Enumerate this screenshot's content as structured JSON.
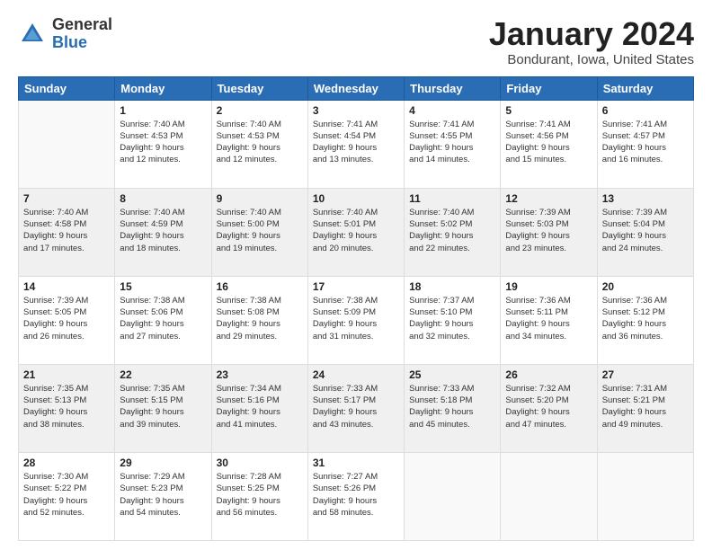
{
  "header": {
    "logo_general": "General",
    "logo_blue": "Blue",
    "title": "January 2024",
    "location": "Bondurant, Iowa, United States"
  },
  "columns": [
    "Sunday",
    "Monday",
    "Tuesday",
    "Wednesday",
    "Thursday",
    "Friday",
    "Saturday"
  ],
  "weeks": [
    [
      {
        "day": "",
        "content": ""
      },
      {
        "day": "1",
        "content": "Sunrise: 7:40 AM\nSunset: 4:53 PM\nDaylight: 9 hours\nand 12 minutes."
      },
      {
        "day": "2",
        "content": "Sunrise: 7:40 AM\nSunset: 4:53 PM\nDaylight: 9 hours\nand 12 minutes."
      },
      {
        "day": "3",
        "content": "Sunrise: 7:41 AM\nSunset: 4:54 PM\nDaylight: 9 hours\nand 13 minutes."
      },
      {
        "day": "4",
        "content": "Sunrise: 7:41 AM\nSunset: 4:55 PM\nDaylight: 9 hours\nand 14 minutes."
      },
      {
        "day": "5",
        "content": "Sunrise: 7:41 AM\nSunset: 4:56 PM\nDaylight: 9 hours\nand 15 minutes."
      },
      {
        "day": "6",
        "content": "Sunrise: 7:41 AM\nSunset: 4:57 PM\nDaylight: 9 hours\nand 16 minutes."
      }
    ],
    [
      {
        "day": "7",
        "content": "Sunrise: 7:40 AM\nSunset: 4:58 PM\nDaylight: 9 hours\nand 17 minutes."
      },
      {
        "day": "8",
        "content": "Sunrise: 7:40 AM\nSunset: 4:59 PM\nDaylight: 9 hours\nand 18 minutes."
      },
      {
        "day": "9",
        "content": "Sunrise: 7:40 AM\nSunset: 5:00 PM\nDaylight: 9 hours\nand 19 minutes."
      },
      {
        "day": "10",
        "content": "Sunrise: 7:40 AM\nSunset: 5:01 PM\nDaylight: 9 hours\nand 20 minutes."
      },
      {
        "day": "11",
        "content": "Sunrise: 7:40 AM\nSunset: 5:02 PM\nDaylight: 9 hours\nand 22 minutes."
      },
      {
        "day": "12",
        "content": "Sunrise: 7:39 AM\nSunset: 5:03 PM\nDaylight: 9 hours\nand 23 minutes."
      },
      {
        "day": "13",
        "content": "Sunrise: 7:39 AM\nSunset: 5:04 PM\nDaylight: 9 hours\nand 24 minutes."
      }
    ],
    [
      {
        "day": "14",
        "content": "Sunrise: 7:39 AM\nSunset: 5:05 PM\nDaylight: 9 hours\nand 26 minutes."
      },
      {
        "day": "15",
        "content": "Sunrise: 7:38 AM\nSunset: 5:06 PM\nDaylight: 9 hours\nand 27 minutes."
      },
      {
        "day": "16",
        "content": "Sunrise: 7:38 AM\nSunset: 5:08 PM\nDaylight: 9 hours\nand 29 minutes."
      },
      {
        "day": "17",
        "content": "Sunrise: 7:38 AM\nSunset: 5:09 PM\nDaylight: 9 hours\nand 31 minutes."
      },
      {
        "day": "18",
        "content": "Sunrise: 7:37 AM\nSunset: 5:10 PM\nDaylight: 9 hours\nand 32 minutes."
      },
      {
        "day": "19",
        "content": "Sunrise: 7:36 AM\nSunset: 5:11 PM\nDaylight: 9 hours\nand 34 minutes."
      },
      {
        "day": "20",
        "content": "Sunrise: 7:36 AM\nSunset: 5:12 PM\nDaylight: 9 hours\nand 36 minutes."
      }
    ],
    [
      {
        "day": "21",
        "content": "Sunrise: 7:35 AM\nSunset: 5:13 PM\nDaylight: 9 hours\nand 38 minutes."
      },
      {
        "day": "22",
        "content": "Sunrise: 7:35 AM\nSunset: 5:15 PM\nDaylight: 9 hours\nand 39 minutes."
      },
      {
        "day": "23",
        "content": "Sunrise: 7:34 AM\nSunset: 5:16 PM\nDaylight: 9 hours\nand 41 minutes."
      },
      {
        "day": "24",
        "content": "Sunrise: 7:33 AM\nSunset: 5:17 PM\nDaylight: 9 hours\nand 43 minutes."
      },
      {
        "day": "25",
        "content": "Sunrise: 7:33 AM\nSunset: 5:18 PM\nDaylight: 9 hours\nand 45 minutes."
      },
      {
        "day": "26",
        "content": "Sunrise: 7:32 AM\nSunset: 5:20 PM\nDaylight: 9 hours\nand 47 minutes."
      },
      {
        "day": "27",
        "content": "Sunrise: 7:31 AM\nSunset: 5:21 PM\nDaylight: 9 hours\nand 49 minutes."
      }
    ],
    [
      {
        "day": "28",
        "content": "Sunrise: 7:30 AM\nSunset: 5:22 PM\nDaylight: 9 hours\nand 52 minutes."
      },
      {
        "day": "29",
        "content": "Sunrise: 7:29 AM\nSunset: 5:23 PM\nDaylight: 9 hours\nand 54 minutes."
      },
      {
        "day": "30",
        "content": "Sunrise: 7:28 AM\nSunset: 5:25 PM\nDaylight: 9 hours\nand 56 minutes."
      },
      {
        "day": "31",
        "content": "Sunrise: 7:27 AM\nSunset: 5:26 PM\nDaylight: 9 hours\nand 58 minutes."
      },
      {
        "day": "",
        "content": ""
      },
      {
        "day": "",
        "content": ""
      },
      {
        "day": "",
        "content": ""
      }
    ]
  ]
}
